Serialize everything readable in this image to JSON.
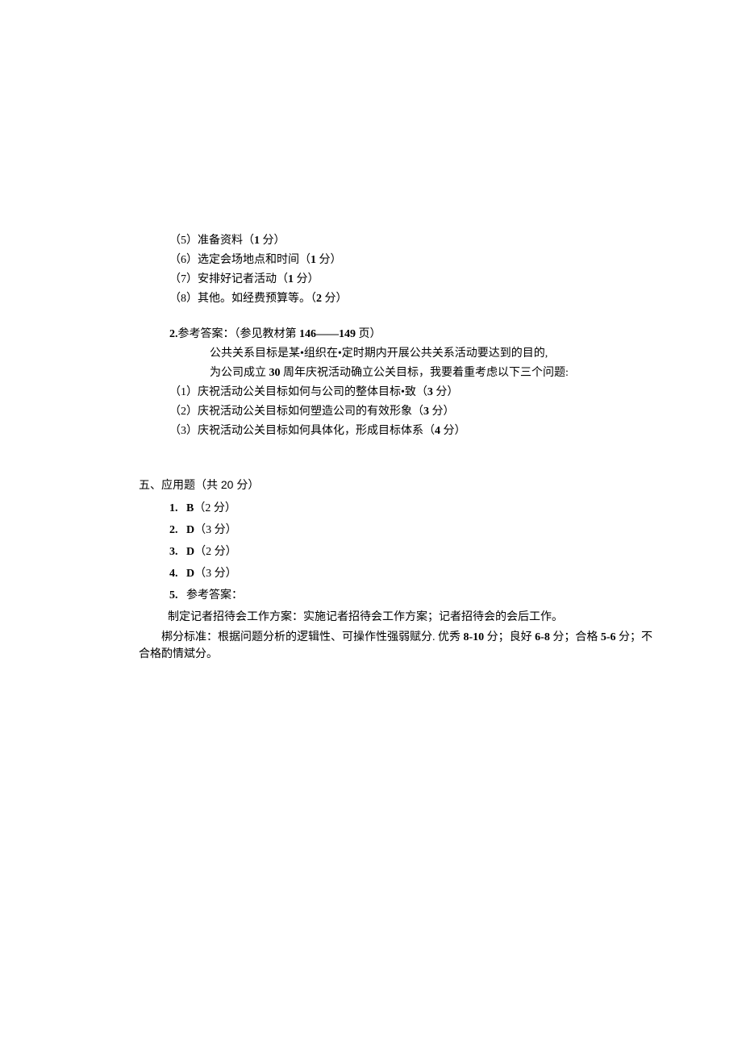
{
  "section1": {
    "items": [
      {
        "num": "（5）",
        "text": "准备资料（",
        "bold": "1",
        "suffix": " 分）"
      },
      {
        "num": "（6）",
        "text": "选定会场地点和时间（",
        "bold": "1",
        "suffix": " 分）"
      },
      {
        "num": "（7）",
        "text": "安排好记者活动（",
        "bold": "1",
        "suffix": " 分）"
      },
      {
        "num": "（8）",
        "text": "其他。如经费预算等。（",
        "bold": "2",
        "suffix": " 分）"
      }
    ]
  },
  "section2": {
    "head_prefix": "2.",
    "head_text": "参考答案：（参见教材第 ",
    "head_bold": "146——149",
    "head_suffix": " 页）",
    "line1": "公共关系目标是某•组织在•定时期内开展公共关系活动要达到的目的,",
    "line2_pre": "为公司成立 ",
    "line2_bold": "30",
    "line2_suf": " 周年庆祝活动确立公关目标，我要着重考虑以下三个问题:",
    "items": [
      {
        "num": "（1）",
        "text": "庆祝活动公关目标如何与公司的整体目标•致（",
        "bold": "3",
        "suffix": " 分）"
      },
      {
        "num": "（2）",
        "text": "庆祝活动公关目标如何塑造公司的有效形象（",
        "bold": "3",
        "suffix": " 分）"
      },
      {
        "num": "（3）",
        "text": "庆祝活动公关目标如何具体化，形成目标体系（",
        "bold": "4",
        "suffix": " 分）"
      }
    ]
  },
  "section5": {
    "title": "五、应用题（共 20 分）",
    "items": [
      {
        "num": "1.",
        "letter": "B",
        "score": "（2 分）"
      },
      {
        "num": "2.",
        "letter": "D",
        "score": "（3 分）"
      },
      {
        "num": "3.",
        "letter": "D",
        "score": "（2 分）"
      },
      {
        "num": "4.",
        "letter": "D",
        "score": "（3 分）"
      },
      {
        "num": "5.",
        "letter": "",
        "score": "参考答案："
      }
    ],
    "ans1": "制定记者招待会工作方案：实施记者招待会工作方案；记者招待会的会后工作。",
    "ans2_pre": "梆分标准：根据问题分析的逻辑性、可操作性强弱赋分. 优秀 ",
    "ans2_b1": "8-10",
    "ans2_m1": " 分；良好 ",
    "ans2_b2": "6-8",
    "ans2_m2": " 分；合格 ",
    "ans2_b3": "5-6",
    "ans2_m3": " 分；不合格酌情斌分。"
  }
}
